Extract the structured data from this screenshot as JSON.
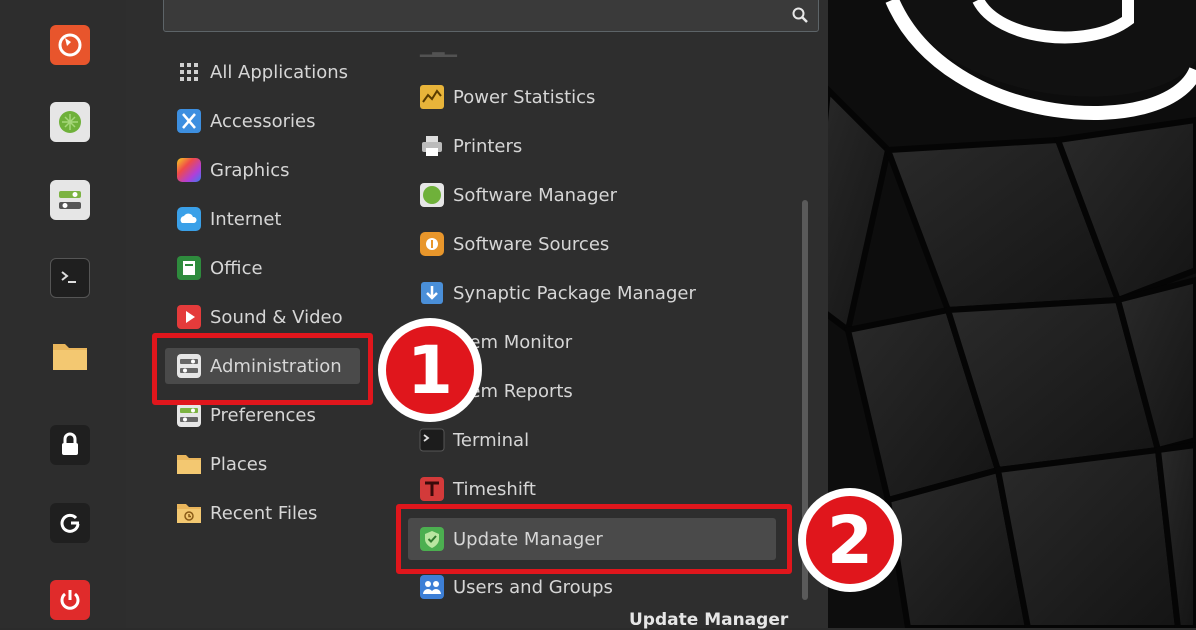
{
  "search": {
    "placeholder": "",
    "icon": "search-icon"
  },
  "favorites": [
    {
      "name": "firefox",
      "icon": "firefox-icon",
      "color": "#e8552c"
    },
    {
      "name": "software",
      "icon": "software-manager-icon",
      "color": "#7cb342"
    },
    {
      "name": "settings",
      "icon": "system-settings-icon",
      "color": "#dddddd"
    },
    {
      "name": "terminal",
      "icon": "terminal-icon",
      "color": "#222222"
    },
    {
      "name": "files",
      "icon": "folder-icon",
      "color": "#e6b35a"
    },
    {
      "name": "lock",
      "icon": "lock-icon",
      "color": "#2a2a2a"
    },
    {
      "name": "logout",
      "icon": "logout-icon",
      "color": "#2a2a2a"
    },
    {
      "name": "shutdown",
      "icon": "power-icon",
      "color": "#e02b2b"
    }
  ],
  "categories": [
    {
      "label": "All Applications",
      "icon": "grid-icon"
    },
    {
      "label": "Accessories",
      "icon": "accessories-icon"
    },
    {
      "label": "Graphics",
      "icon": "graphics-icon"
    },
    {
      "label": "Internet",
      "icon": "internet-icon"
    },
    {
      "label": "Office",
      "icon": "office-icon"
    },
    {
      "label": "Sound & Video",
      "icon": "sound-video-icon"
    },
    {
      "label": "Administration",
      "icon": "administration-icon",
      "selected": true
    },
    {
      "label": "Preferences",
      "icon": "preferences-icon"
    },
    {
      "label": "Places",
      "icon": "places-folder-icon"
    },
    {
      "label": "Recent Files",
      "icon": "recent-files-icon"
    }
  ],
  "apps": [
    {
      "label": "Power Statistics",
      "icon": "power-statistics-icon"
    },
    {
      "label": "Printers",
      "icon": "printer-icon"
    },
    {
      "label": "Software Manager",
      "icon": "software-manager-icon"
    },
    {
      "label": "Software Sources",
      "icon": "software-sources-icon"
    },
    {
      "label": "Synaptic Package Manager",
      "icon": "synaptic-icon"
    },
    {
      "label": "stem Monitor",
      "icon": "system-monitor-icon"
    },
    {
      "label": "stem Reports",
      "icon": "system-reports-icon"
    },
    {
      "label": "Terminal",
      "icon": "terminal-icon"
    },
    {
      "label": "Timeshift",
      "icon": "timeshift-icon"
    },
    {
      "label": "Update Manager",
      "icon": "update-manager-icon",
      "selected": true
    },
    {
      "label": "Users and Groups",
      "icon": "users-groups-icon"
    }
  ],
  "badges": {
    "step1": "1",
    "step2": "2"
  },
  "description": "Update Manager",
  "colors": {
    "highlight": "#e0161c",
    "selected_bg": "#4a4a4a",
    "panel_bg": "#2e2e2e"
  }
}
